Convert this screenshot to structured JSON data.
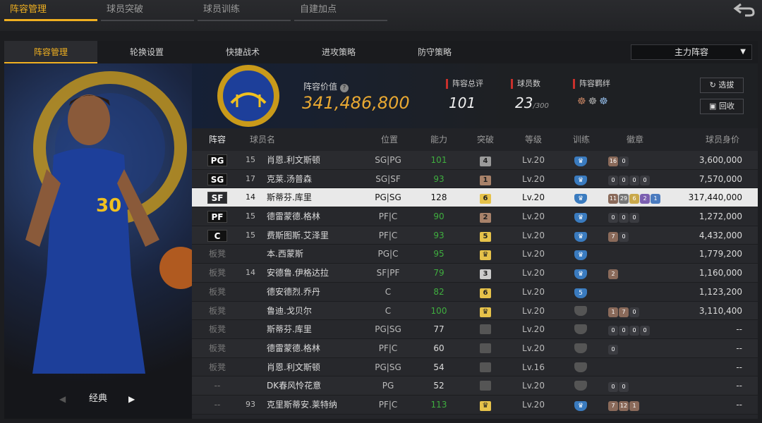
{
  "top_tabs": [
    "阵容管理",
    "球员突破",
    "球员训练",
    "自建加点"
  ],
  "sub_tabs": [
    "阵容管理",
    "轮换设置",
    "快捷战术",
    "进攻策略",
    "防守策略"
  ],
  "lineup_select": "主力阵容",
  "player_nav": "经典",
  "header": {
    "value_label": "阵容价值",
    "value": "341,486,800",
    "rating_label": "阵容总评",
    "rating": "101",
    "count_label": "球员数",
    "count": "23",
    "count_max": "/300",
    "bond_label": "阵容羁绊",
    "btn_choose": "选拔",
    "btn_recycle": "回收"
  },
  "columns": [
    "阵容",
    "球员名",
    "位置",
    "能力",
    "突破",
    "等级",
    "训练",
    "徽章",
    "球员身价"
  ],
  "rows": [
    {
      "slot": "PG",
      "num": "15",
      "name": "肖恩.利文斯顿",
      "pos": "SG|PG",
      "ability": "101",
      "green": true,
      "brk": "4",
      "brkc": "#9a9a9a",
      "lvl": "Lv.20",
      "train": "blue",
      "badges": [
        "16",
        "0"
      ],
      "val": "3,600,000"
    },
    {
      "slot": "SG",
      "num": "17",
      "name": "克莱.汤普森",
      "pos": "SG|SF",
      "ability": "93",
      "green": true,
      "brk": "1",
      "brkc": "#a8826a",
      "lvl": "Lv.20",
      "train": "blue",
      "badges": [
        "0",
        "0",
        "0",
        "0"
      ],
      "val": "7,570,000"
    },
    {
      "slot": "SF",
      "num": "14",
      "name": "斯蒂芬.库里",
      "pos": "PG|SG",
      "ability": "128",
      "green": false,
      "brk": "6",
      "brkc": "#e6c24a",
      "lvl": "Lv.20",
      "train": "blue",
      "badges": [
        "11",
        "29",
        "6",
        "2",
        "1"
      ],
      "val": "317,440,000",
      "sel": true
    },
    {
      "slot": "PF",
      "num": "15",
      "name": "德雷蒙德.格林",
      "pos": "PF|C",
      "ability": "90",
      "green": true,
      "brk": "2",
      "brkc": "#a8826a",
      "lvl": "Lv.20",
      "train": "blue",
      "badges": [
        "0",
        "0",
        "0"
      ],
      "val": "1,272,000"
    },
    {
      "slot": "C",
      "num": "15",
      "name": "费斯图斯.艾泽里",
      "pos": "PF|C",
      "ability": "93",
      "green": true,
      "brk": "5",
      "brkc": "#e6c24a",
      "lvl": "Lv.20",
      "train": "blue",
      "badges": [
        "7",
        "0"
      ],
      "val": "4,432,000"
    },
    {
      "slot": "板凳",
      "num": "",
      "name": "本.西蒙斯",
      "pos": "PG|C",
      "ability": "95",
      "green": true,
      "brk": "♛",
      "brkc": "#e6c24a",
      "lvl": "Lv.20",
      "train": "blue",
      "badges": [],
      "val": "1,779,200"
    },
    {
      "slot": "板凳",
      "num": "14",
      "name": "安德鲁.伊格达拉",
      "pos": "SF|PF",
      "ability": "79",
      "green": true,
      "brk": "3",
      "brkc": "#cccccc",
      "lvl": "Lv.20",
      "train": "blue",
      "badges": [
        "2"
      ],
      "val": "1,160,000"
    },
    {
      "slot": "板凳",
      "num": "",
      "name": "德安德烈.乔丹",
      "pos": "C",
      "ability": "82",
      "green": true,
      "brk": "6",
      "brkc": "#e6c24a",
      "lvl": "Lv.20",
      "train": "blue5",
      "badges": [],
      "val": "1,123,200"
    },
    {
      "slot": "板凳",
      "num": "",
      "name": "鲁迪.戈贝尔",
      "pos": "C",
      "ability": "100",
      "green": true,
      "brk": "♛",
      "brkc": "#e6c24a",
      "lvl": "Lv.20",
      "train": "grey",
      "badges": [
        "1",
        "7",
        "0"
      ],
      "val": "3,110,400"
    },
    {
      "slot": "板凳",
      "num": "",
      "name": "斯蒂芬.库里",
      "pos": "PG|SG",
      "ability": "77",
      "green": false,
      "brk": "",
      "brkc": "#555",
      "lvl": "Lv.20",
      "train": "grey",
      "badges": [
        "0",
        "0",
        "0",
        "0"
      ],
      "val": "--"
    },
    {
      "slot": "板凳",
      "num": "",
      "name": "德雷蒙德.格林",
      "pos": "PF|C",
      "ability": "60",
      "green": false,
      "brk": "",
      "brkc": "#555",
      "lvl": "Lv.20",
      "train": "grey",
      "badges": [
        "0"
      ],
      "val": "--"
    },
    {
      "slot": "板凳",
      "num": "",
      "name": "肖恩.利文斯顿",
      "pos": "PG|SG",
      "ability": "54",
      "green": false,
      "brk": "",
      "brkc": "#555",
      "lvl": "Lv.16",
      "train": "grey",
      "badges": [],
      "val": "--"
    },
    {
      "slot": "--",
      "num": "",
      "name": "DK春风怜花意",
      "pos": "PG",
      "ability": "52",
      "green": false,
      "brk": "",
      "brkc": "#555",
      "lvl": "Lv.20",
      "train": "grey",
      "badges": [
        "0",
        "0"
      ],
      "val": "--"
    },
    {
      "slot": "--",
      "num": "93",
      "name": "克里斯蒂安.莱特纳",
      "pos": "PF|C",
      "ability": "113",
      "green": true,
      "brk": "♛",
      "brkc": "#e6c24a",
      "lvl": "Lv.20",
      "train": "blue",
      "badges": [
        "7",
        "12",
        "1"
      ],
      "val": "--"
    }
  ]
}
